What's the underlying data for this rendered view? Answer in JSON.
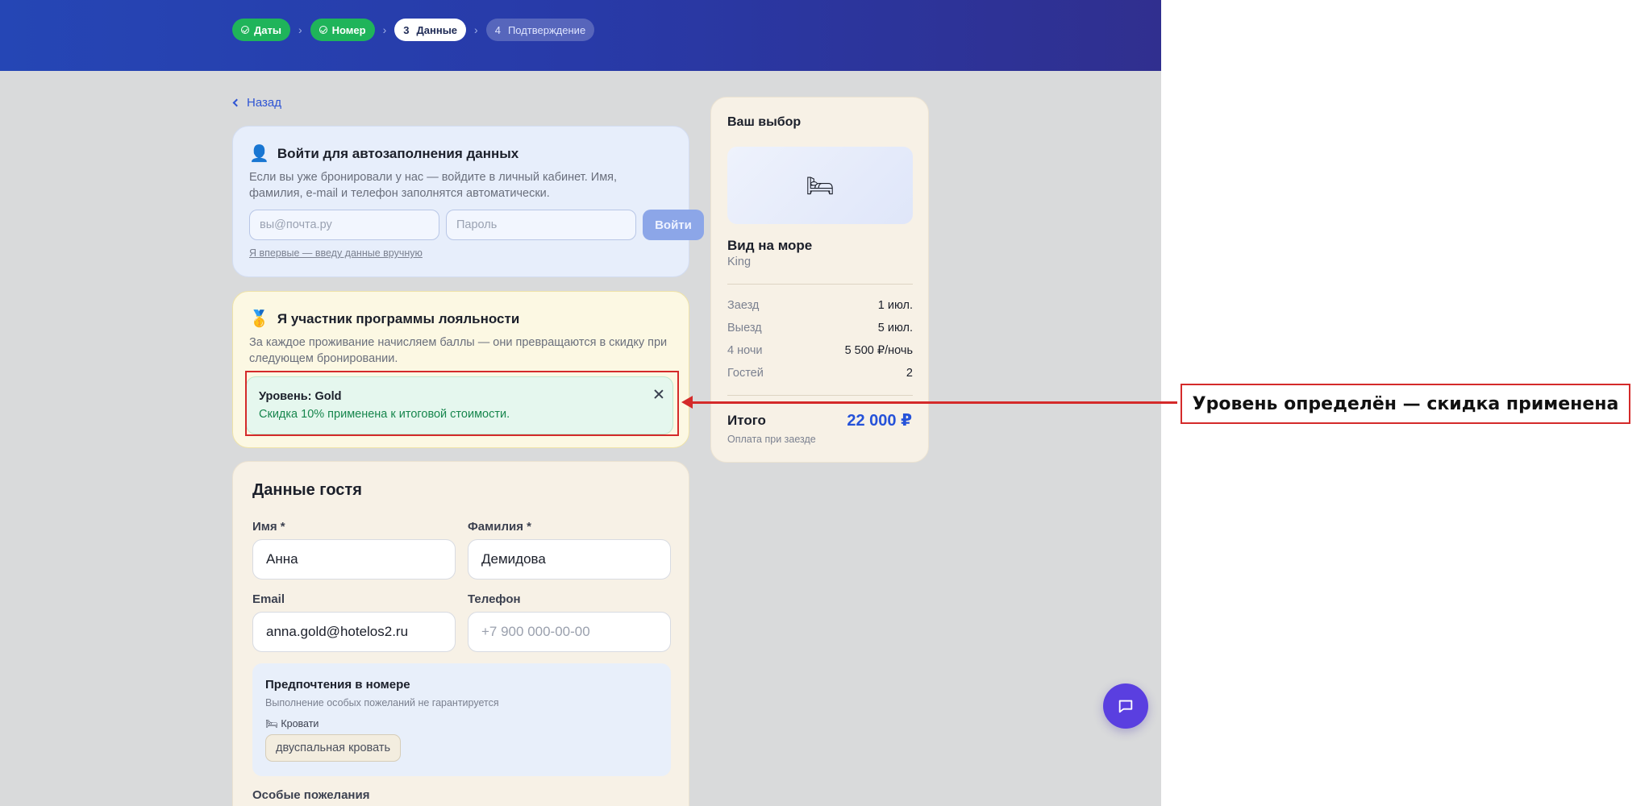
{
  "steps": [
    {
      "label": "Даты",
      "state": "done"
    },
    {
      "label": "Номер",
      "state": "done"
    },
    {
      "num": "3",
      "label": "Данные",
      "state": "active"
    },
    {
      "num": "4",
      "label": "Подтверждение",
      "state": "future"
    }
  ],
  "back_label": "Назад",
  "login": {
    "emoji": "👤",
    "title": "Войти для автозаполнения данных",
    "text": "Если вы уже бронировали у нас — войдите в личный кабинет. Имя, фамилия, e-mail и телефон заполнятся автоматически.",
    "email_placeholder": "вы@почта.ру",
    "password_placeholder": "Пароль",
    "button": "Войти",
    "manual_link": "Я впервые — введу данные вручную"
  },
  "loyalty": {
    "emoji": "🥇",
    "title": "Я участник программы лояльности",
    "text": "За каждое проживание начисляем баллы — они превращаются в скидку при следующем бронировании.",
    "tier_title": "Уровень: Gold",
    "tier_text": "Скидка 10% применена к итоговой стоимости."
  },
  "guest": {
    "title": "Данные гостя",
    "first_name_label": "Имя *",
    "first_name_value": "Анна",
    "last_name_label": "Фамилия *",
    "last_name_value": "Демидова",
    "email_label": "Email",
    "email_value": "anna.gold@hotelos2.ru",
    "phone_label": "Телефон",
    "phone_placeholder": "+7 900 000-00-00",
    "prefs_title": "Предпочтения в номере",
    "prefs_sub": "Выполнение особых пожеланий не гарантируется",
    "prefs_group": "🛏 Кровати",
    "prefs_chip": "двуспальная кровать",
    "special_label": "Особые пожелания"
  },
  "summary": {
    "title": "Ваш выбор",
    "room_emoji": "🛏",
    "room_name": "Вид на море",
    "room_type": "King",
    "checkin_label": "Заезд",
    "checkin_value": "1 июл.",
    "checkout_label": "Выезд",
    "checkout_value": "5 июл.",
    "nights_label": "4 ночи",
    "nights_value": "5 500 ₽/ночь",
    "guests_label": "Гостей",
    "guests_value": "2",
    "total_label": "Итого",
    "total_value": "22 000 ₽",
    "pay_note": "Оплата при заезде"
  },
  "annotation": "Уровень определён — скидка применена",
  "colors": {
    "accent": "#2552d9",
    "success": "#1fb45a",
    "highlight": "#d42a2a",
    "chat": "#5a3fe0"
  }
}
